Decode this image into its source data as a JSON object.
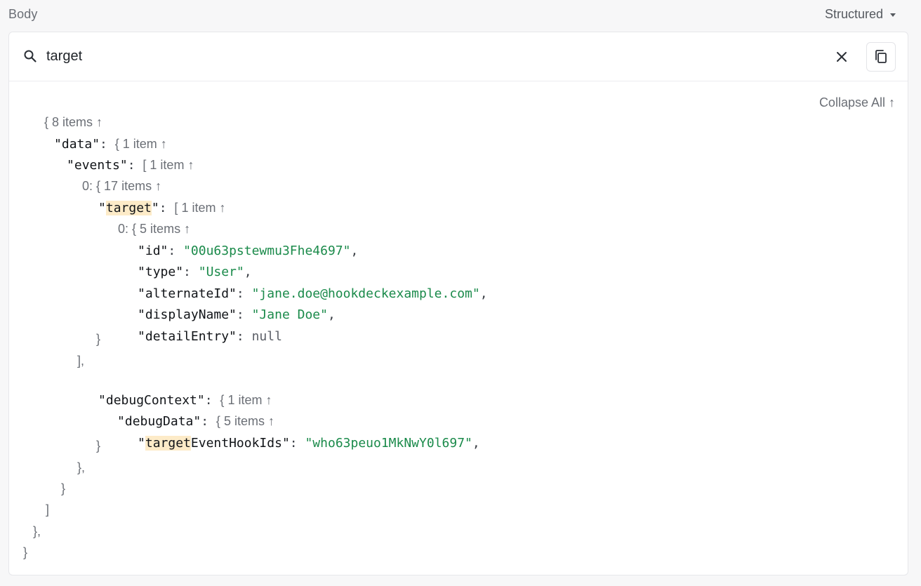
{
  "header": {
    "title": "Body",
    "format": "Structured"
  },
  "search": {
    "value": "target"
  },
  "tree": {
    "collapse_all": "Collapse All ↑",
    "root_meta": "8 items ↑",
    "data_key": "\"data\"",
    "data_meta": "1 item ↑",
    "events_key": "\"events\"",
    "events_meta": "1 item ↑",
    "event0_index": "0:",
    "event0_meta": "17 items ↑",
    "target_key_hl": "target",
    "target_meta": "1 item ↑",
    "target0_index": "0:",
    "target0_meta": "5 items ↑",
    "id_key": "\"id\"",
    "id_value": "\"00u63pstewmu3Fhe4697\"",
    "type_key": "\"type\"",
    "type_value": "\"User\"",
    "alternateId_key": "\"alternateId\"",
    "alternateId_value": "\"jane.doe@hookdeckexample.com\"",
    "displayName_key": "\"displayName\"",
    "displayName_value": "\"Jane Doe\"",
    "detailEntry_key": "\"detailEntry\"",
    "detailEntry_value": "null",
    "debugContext_key": "\"debugContext\"",
    "debugContext_meta": "1 item ↑",
    "debugData_key": "\"debugData\"",
    "debugData_meta": "5 items ↑",
    "targetEventHookIds_hl": "target",
    "targetEventHookIds_rest": "EventHookIds",
    "targetEventHookIds_value": "\"who63peuo1MkNwY0l697\""
  }
}
